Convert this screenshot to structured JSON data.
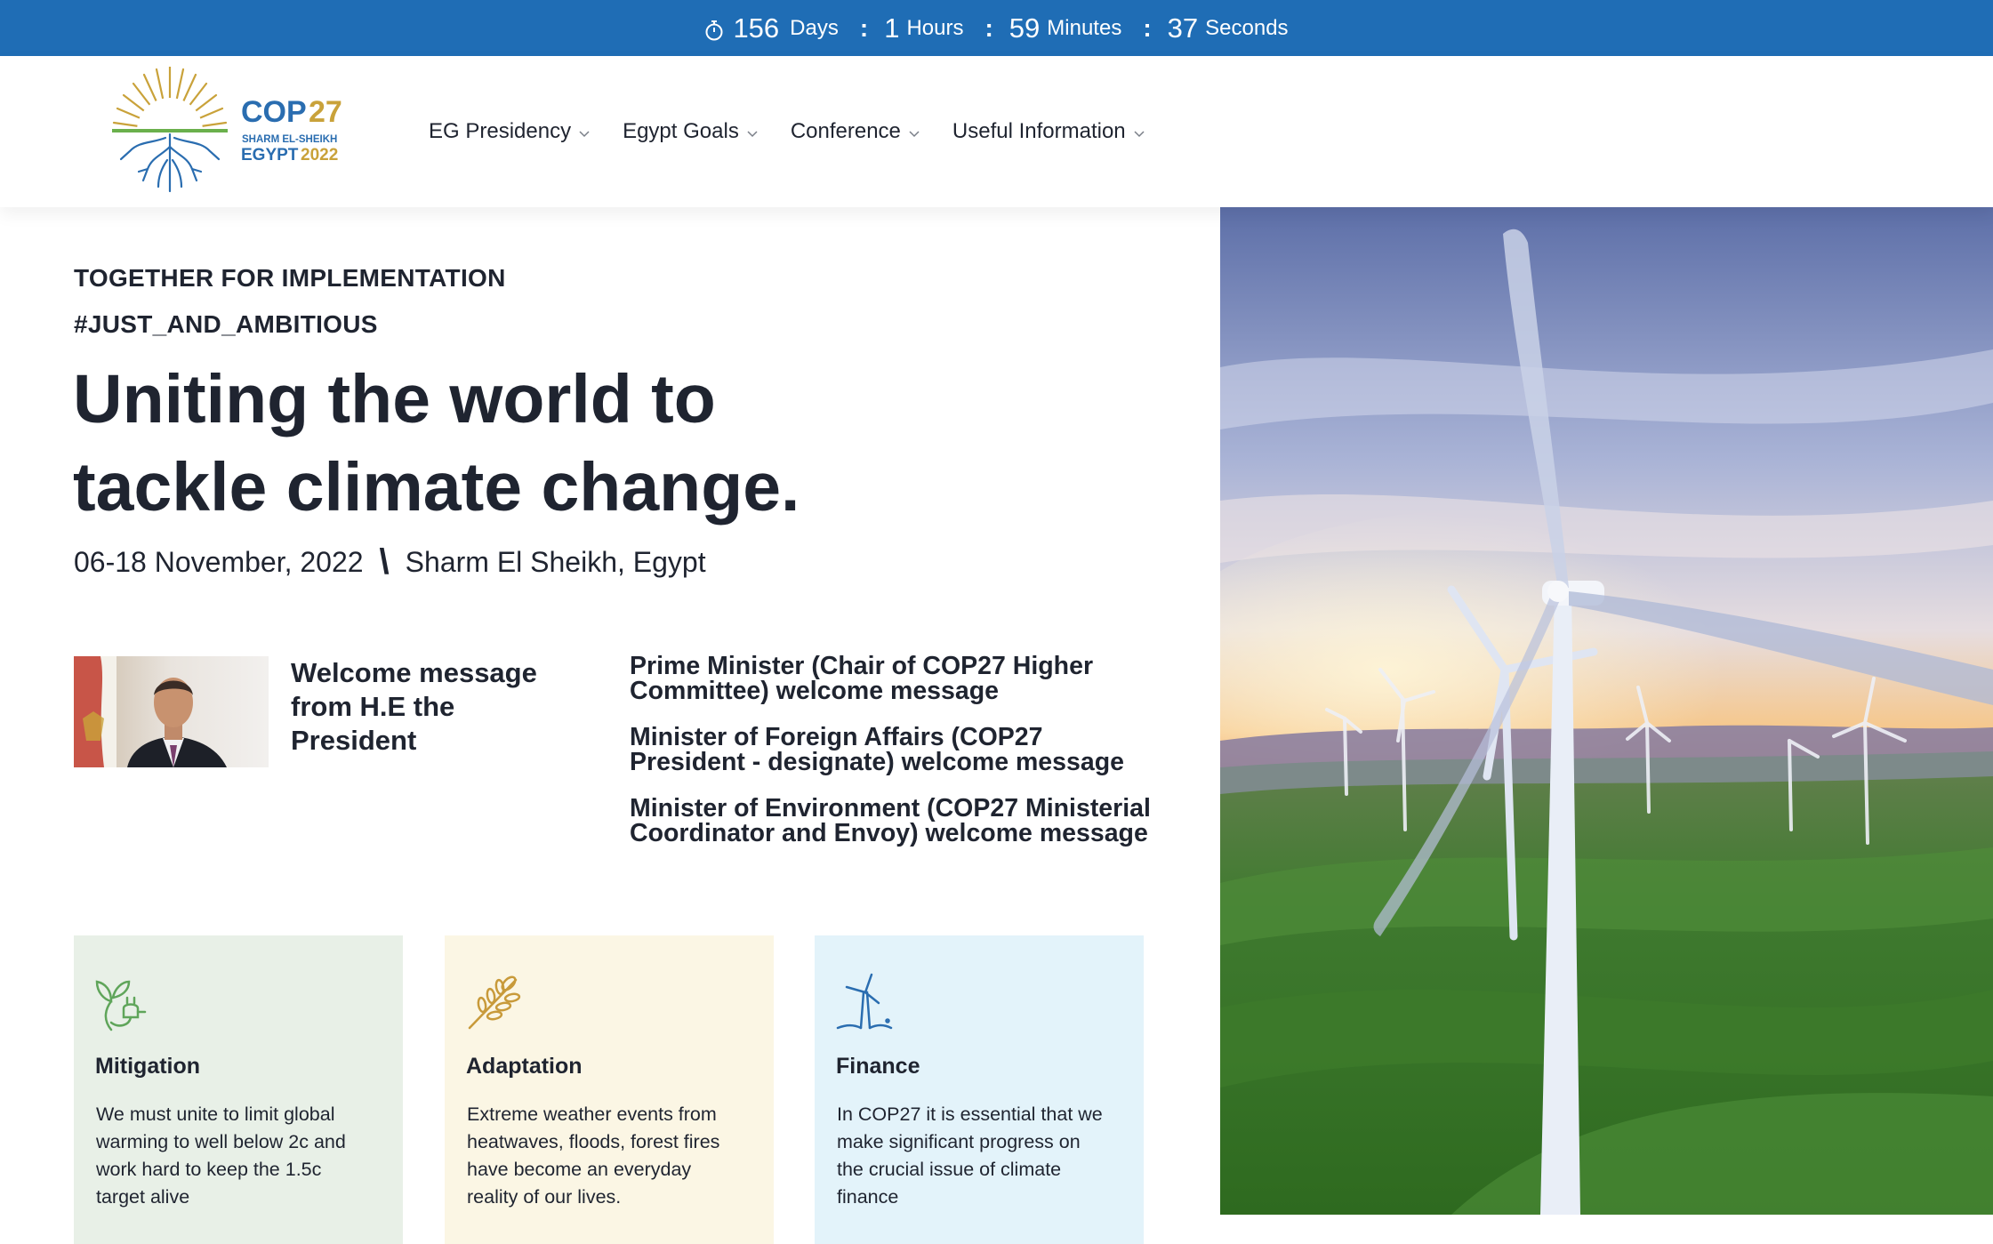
{
  "countdown": {
    "days_value": "156",
    "days_label": "Days",
    "hours_value": "1",
    "hours_label": "Hours",
    "minutes_value": "59",
    "minutes_label": "Minutes",
    "seconds_value": "37",
    "seconds_label": "Seconds",
    "separator": ":",
    "bg_color": "#1f6db5"
  },
  "logo": {
    "line1": "COP27",
    "line2": "SHARM EL-SHEIKH",
    "line3": "EGYPT2022"
  },
  "nav": [
    {
      "label": "EG Presidency"
    },
    {
      "label": "Egypt Goals"
    },
    {
      "label": "Conference"
    },
    {
      "label": "Useful Information"
    }
  ],
  "hero": {
    "kicker1": "TOGETHER FOR IMPLEMENTATION",
    "kicker2": "#JUST_AND_AMBITIOUS",
    "headline_line1": "Uniting the world to",
    "headline_line2": "tackle climate change.",
    "dates": "06-18 November, 2022",
    "separator": "\\",
    "location": "Sharm El Sheikh, Egypt"
  },
  "president": {
    "title": "Welcome message from H.E the President"
  },
  "messages": [
    {
      "label": "Prime Minister (Chair of COP27 Higher Committee) welcome message"
    },
    {
      "label": "Minister of Foreign Affairs (COP27 President - designate) welcome message"
    },
    {
      "label": "Minister of Environment (COP27 Ministerial Coordinator and Envoy) welcome message"
    }
  ],
  "cards": [
    {
      "title": "Mitigation",
      "text": "We must unite to limit global warming to well below 2c and work hard to keep the 1.5c target alive",
      "icon": "plant-plug-icon",
      "bg": "#e8f0e7",
      "icon_color": "#5fa55a"
    },
    {
      "title": "Adaptation",
      "text": "Extreme weather events from heatwaves, floods, forest fires have become an everyday reality of our lives.",
      "icon": "wheat-icon",
      "bg": "#fbf6e4",
      "icon_color": "#c89a3a"
    },
    {
      "title": "Finance",
      "text": "In COP27 it is essential that we make significant progress on the crucial issue of climate finance",
      "icon": "wind-turbine-icon",
      "bg": "#e3f3fa",
      "icon_color": "#2a6db0"
    }
  ]
}
